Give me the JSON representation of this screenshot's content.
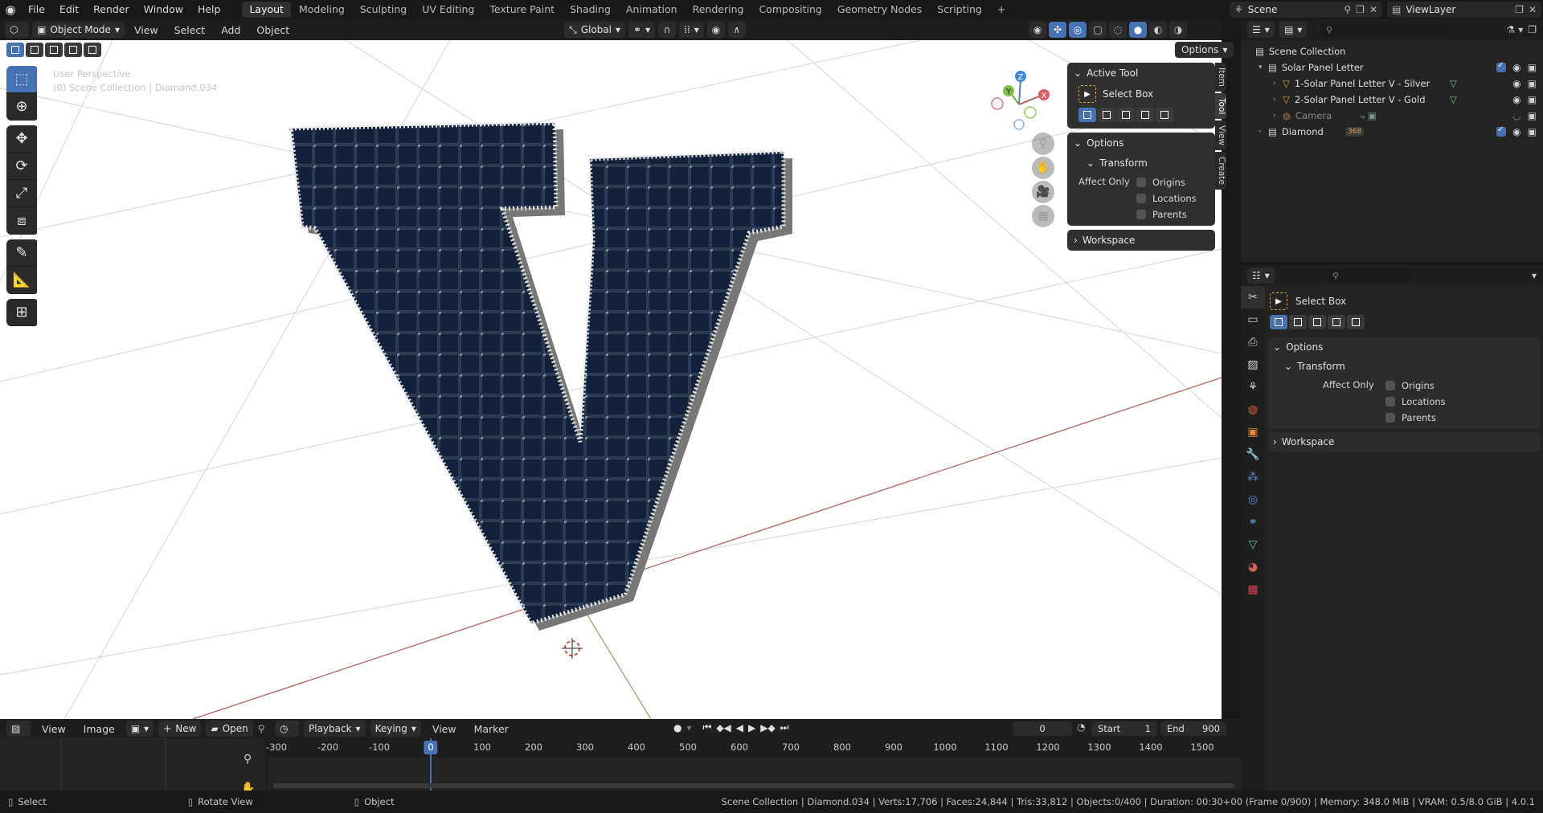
{
  "topbar": {
    "menus": [
      "File",
      "Edit",
      "Render",
      "Window",
      "Help"
    ],
    "workspaces": [
      "Layout",
      "Modeling",
      "Sculpting",
      "UV Editing",
      "Texture Paint",
      "Shading",
      "Animation",
      "Rendering",
      "Compositing",
      "Geometry Nodes",
      "Scripting"
    ],
    "active_workspace": "Layout",
    "add_workspace": "+",
    "scene": "Scene",
    "view_layer": "ViewLayer"
  },
  "viewport_header": {
    "mode": "Object Mode",
    "menus": [
      "View",
      "Select",
      "Add",
      "Object"
    ],
    "transform_orientation": "Global",
    "options_label": "Options"
  },
  "viewport": {
    "perspective": "User Perspective",
    "context": "(0) Scene Collection | Diamond.034",
    "gizmo_labels": {
      "z": "Z",
      "y": "Y",
      "x": "X"
    }
  },
  "npanel": {
    "active_tool_title": "Active Tool",
    "tool_name": "Select Box",
    "options_title": "Options",
    "transform_title": "Transform",
    "affect_only_label": "Affect Only",
    "checks": [
      "Origins",
      "Locations",
      "Parents"
    ],
    "workspace_title": "Workspace",
    "tabs": [
      "Item",
      "Tool",
      "View",
      "Create"
    ]
  },
  "outliner": {
    "scene_collection": "Scene Collection",
    "rows": [
      {
        "label": "Solar Panel Letter",
        "level": 1
      },
      {
        "label": "1-Solar Panel Letter V - Silver",
        "level": 2
      },
      {
        "label": "2-Solar Panel Letter V - Gold",
        "level": 2
      },
      {
        "label": "Camera",
        "level": 2
      },
      {
        "label": "Diamond",
        "level": 1
      }
    ],
    "diamond_badge": "368"
  },
  "properties": {
    "tool_name": "Select Box",
    "options_title": "Options",
    "transform_title": "Transform",
    "affect_only_label": "Affect Only",
    "checks": [
      "Origins",
      "Locations",
      "Parents"
    ],
    "workspace_title": "Workspace"
  },
  "image_editor": {
    "menus": [
      "View",
      "Image"
    ],
    "new_label": "New",
    "open_label": "Open"
  },
  "timeline": {
    "menus": [
      "Playback",
      "Keying",
      "View",
      "Marker"
    ],
    "current_frame": "0",
    "start_label": "Start",
    "start_value": "1",
    "end_label": "End",
    "end_value": "900",
    "ticks": [
      "-300",
      "-200",
      "-100",
      "0",
      "100",
      "200",
      "300",
      "400",
      "500",
      "600",
      "700",
      "800",
      "900",
      "1000",
      "1100",
      "1200",
      "1300",
      "1400",
      "1500"
    ],
    "cursor_label": "0"
  },
  "statusbar": {
    "select": "Select",
    "rotate_view": "Rotate View",
    "object": "Object",
    "stats": "Scene Collection | Diamond.034 | Verts:17,706 | Faces:24,844 | Tris:33,812 | Objects:0/400 | Duration: 00:30+00 (Frame 0/900) | Memory: 348.0 MiB | VRAM: 0.5/8.0 GiB | 4.0.1"
  },
  "colors": {
    "accent": "#4772b3",
    "panel": "#303030",
    "header": "#1f1f1f",
    "viewport_bg": "#ffffff"
  }
}
